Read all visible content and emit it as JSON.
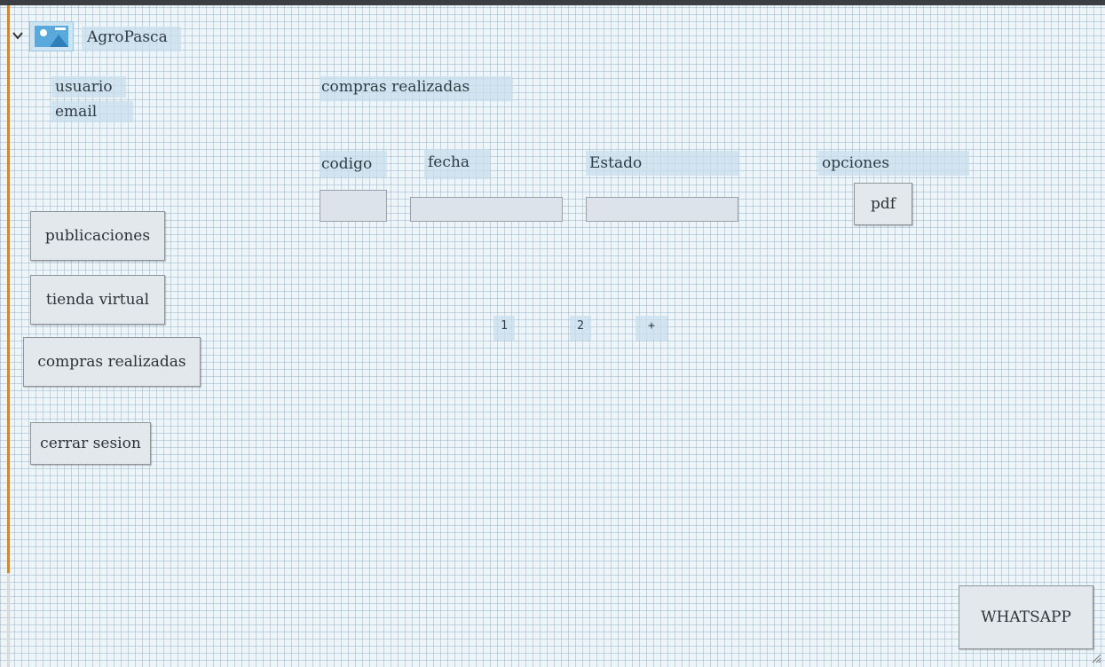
{
  "app": {
    "title": "AgroPasca"
  },
  "profile": {
    "user_label": "usuario",
    "email_label": "email"
  },
  "sidebar": {
    "buttons": [
      {
        "label": "publicaciones"
      },
      {
        "label": "tienda virtual"
      },
      {
        "label": "compras realizadas"
      },
      {
        "label": "cerrar sesion"
      }
    ]
  },
  "main": {
    "section_title": "compras realizadas",
    "columns": [
      "codigo",
      "fecha",
      "Estado",
      "opciones"
    ],
    "row": {
      "codigo": "",
      "fecha": "",
      "estado": "",
      "option_button": "pdf"
    },
    "pagination": [
      "1",
      "2",
      "+"
    ]
  },
  "whatsapp": {
    "label": "WHATSAPP"
  },
  "icons": [
    "chevron-down-icon",
    "image-logo-icon",
    "resize-grip-icon"
  ],
  "colors": {
    "grid_background": "#eef5f9",
    "frame_accent": "#c88a3a",
    "label_highlight": "#c8deeb"
  }
}
